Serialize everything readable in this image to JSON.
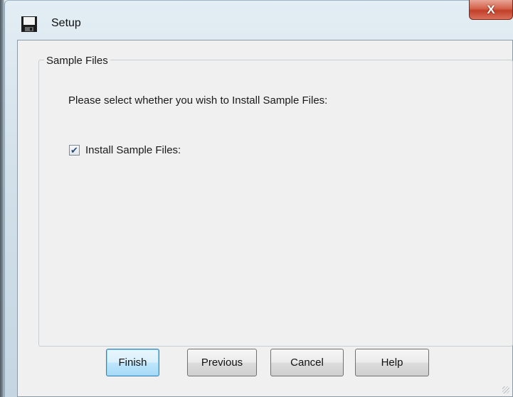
{
  "window": {
    "title": "Setup",
    "close_label": "X"
  },
  "group": {
    "legend": "Sample Files",
    "prompt": "Please select whether you wish to Install Sample Files:",
    "checkbox_label": "Install Sample Files:",
    "checkbox_checked": true
  },
  "buttons": {
    "finish": "Finish",
    "previous": "Previous",
    "cancel": "Cancel",
    "help": "Help"
  },
  "icons": {
    "title": "floppy-disk-icon",
    "close": "close-icon",
    "check": "checkmark-icon"
  }
}
